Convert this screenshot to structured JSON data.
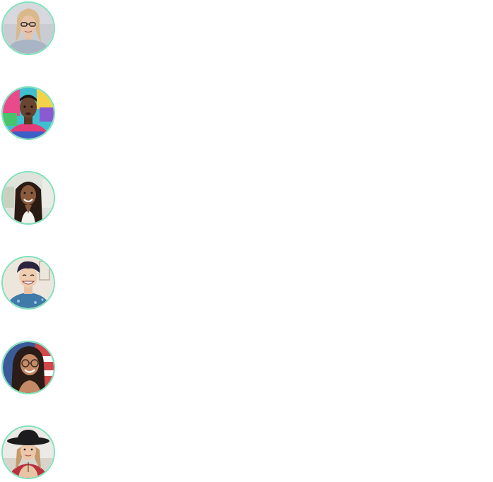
{
  "avatars": [
    {
      "name": "avatar-1",
      "ring_color": "#7ee2b8",
      "description_icon": "person-photo"
    },
    {
      "name": "avatar-2",
      "ring_color": "#7ee2b8",
      "description_icon": "person-photo"
    },
    {
      "name": "avatar-3",
      "ring_color": "#7ee2b8",
      "description_icon": "person-photo"
    },
    {
      "name": "avatar-4",
      "ring_color": "#7ee2b8",
      "description_icon": "person-photo"
    },
    {
      "name": "avatar-5",
      "ring_color": "#7ee2b8",
      "description_icon": "person-photo"
    },
    {
      "name": "avatar-6",
      "ring_color": "#7ee2b8",
      "description_icon": "person-photo"
    }
  ]
}
